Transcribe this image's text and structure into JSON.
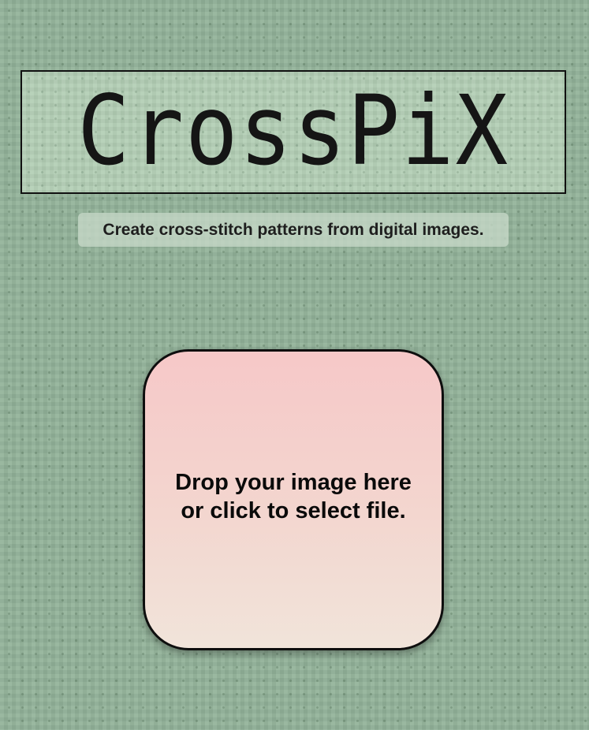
{
  "app": {
    "logo_text": "CrossPiX",
    "tagline": "Create cross-stitch patterns from digital images."
  },
  "dropzone": {
    "label": "Drop your image here\n or click to select file."
  },
  "colors": {
    "background": "#93b39a",
    "logo_background": "#b0ccb2",
    "dropzone_top": "#f6c8c8",
    "dropzone_bottom": "#f1e4da",
    "text": "#1e1e1e"
  }
}
